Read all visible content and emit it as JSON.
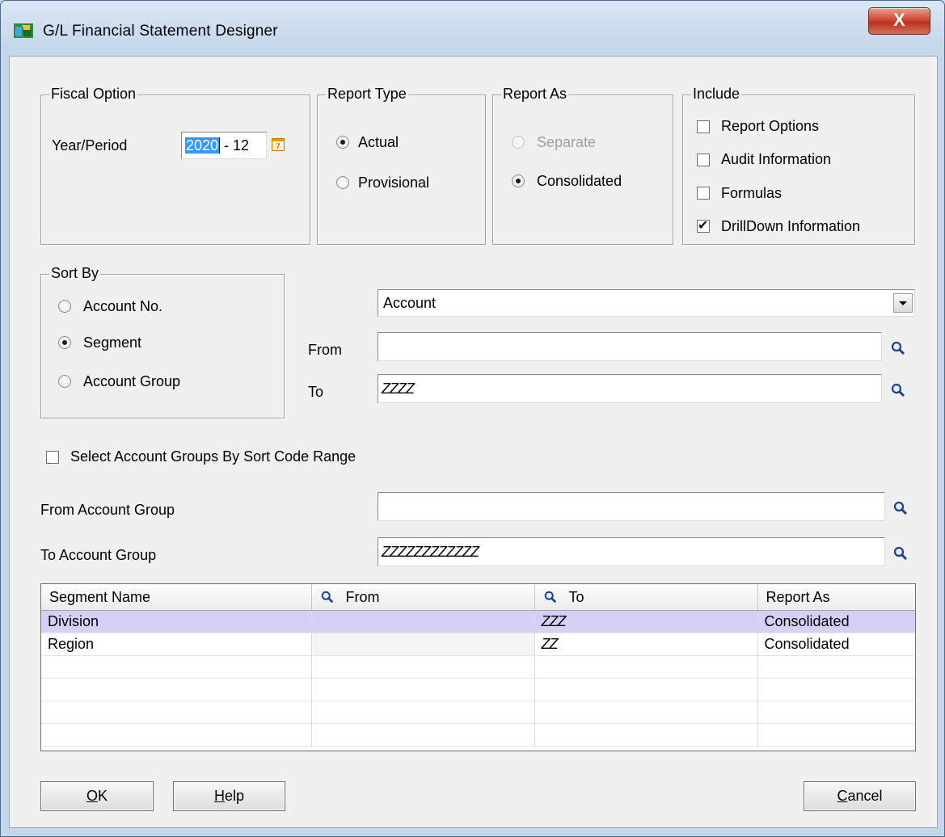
{
  "window": {
    "title": "G/L Financial Statement Designer",
    "close_glyph": "X"
  },
  "fiscal": {
    "group_label": "Fiscal Option",
    "year_period_label": "Year/Period",
    "year": "2020",
    "period": " - 12"
  },
  "report_type": {
    "group_label": "Report Type",
    "actual": "Actual",
    "provisional": "Provisional",
    "selected": "Actual"
  },
  "report_as": {
    "group_label": "Report As",
    "separate": "Separate",
    "consolidated": "Consolidated",
    "selected": "Consolidated"
  },
  "include": {
    "group_label": "Include",
    "report_options": {
      "label": "Report Options",
      "checked": false
    },
    "audit_information": {
      "label": "Audit Information",
      "checked": false
    },
    "formulas": {
      "label": "Formulas",
      "checked": false
    },
    "drilldown": {
      "label": "DrillDown Information",
      "checked": true
    }
  },
  "sort_by": {
    "group_label": "Sort By",
    "account_no": "Account No.",
    "segment": "Segment",
    "account_group": "Account Group",
    "selected": "Segment"
  },
  "range": {
    "dropdown_value": "Account",
    "from_label": "From",
    "from_value": "",
    "to_label": "To",
    "to_value": "ZZZZ"
  },
  "sort_code": {
    "label": "Select Account Groups By Sort Code Range",
    "checked": false
  },
  "account_group": {
    "from_label": "From Account Group",
    "from_value": "",
    "to_label": "To Account Group",
    "to_value": "ZZZZZZZZZZZZ"
  },
  "segments": {
    "columns": [
      "Segment Name",
      "From",
      "To",
      "Report As"
    ],
    "rows": [
      {
        "name": "Division",
        "from": "",
        "to": "ZZZ",
        "report_as": "Consolidated"
      },
      {
        "name": "Region",
        "from": "",
        "to": "ZZ",
        "report_as": "Consolidated"
      }
    ]
  },
  "buttons": {
    "ok_u": "O",
    "ok_rest": "K",
    "help_u": "H",
    "help_rest": "elp",
    "cancel_u": "C",
    "cancel_rest": "ancel"
  },
  "colors": {
    "selected_row": "#d3d1f5",
    "selection_highlight": "#3399ff",
    "close_button": "#c8432e"
  }
}
